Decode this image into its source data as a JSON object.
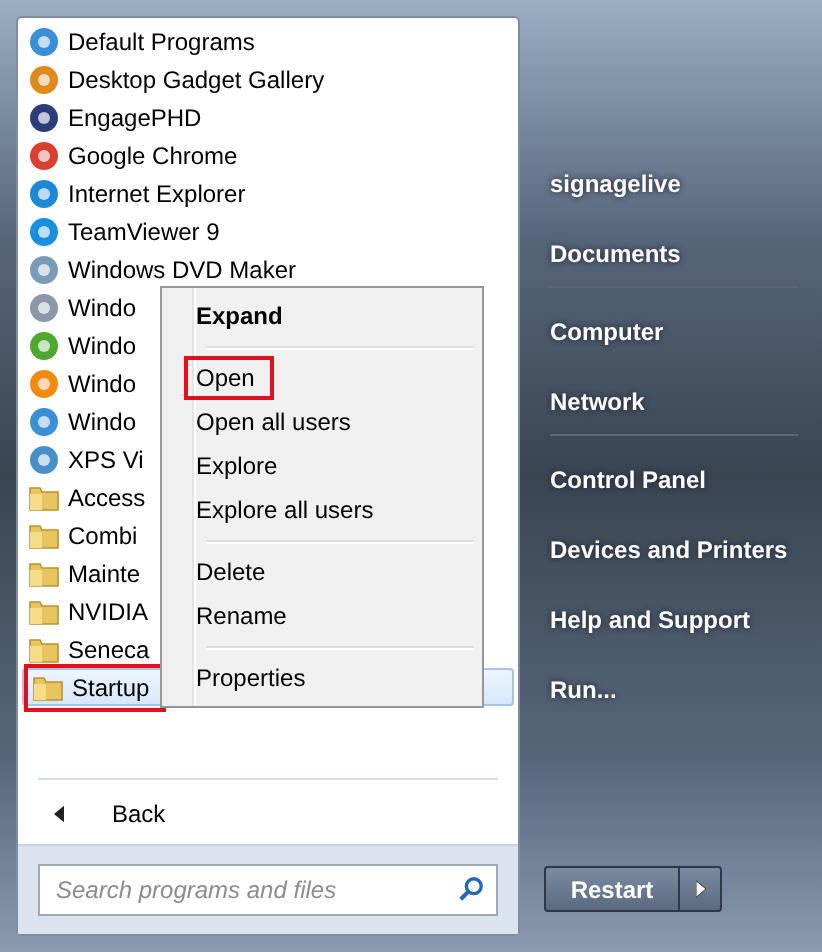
{
  "programs": [
    {
      "label": "Default Programs",
      "kind": "program",
      "selected": false,
      "outlined": false
    },
    {
      "label": "Desktop Gadget Gallery",
      "kind": "program",
      "selected": false,
      "outlined": false
    },
    {
      "label": "EngagePHD",
      "kind": "program",
      "selected": false,
      "outlined": false
    },
    {
      "label": "Google Chrome",
      "kind": "program",
      "selected": false,
      "outlined": false
    },
    {
      "label": "Internet Explorer",
      "kind": "program",
      "selected": false,
      "outlined": false
    },
    {
      "label": "TeamViewer 9",
      "kind": "program",
      "selected": false,
      "outlined": false
    },
    {
      "label": "Windows DVD Maker",
      "kind": "program",
      "selected": false,
      "outlined": false
    },
    {
      "label": "Windo",
      "kind": "program",
      "selected": false,
      "outlined": false
    },
    {
      "label": "Windo",
      "kind": "program",
      "selected": false,
      "outlined": false
    },
    {
      "label": "Windo",
      "kind": "program",
      "selected": false,
      "outlined": false
    },
    {
      "label": "Windo",
      "kind": "program",
      "selected": false,
      "outlined": false
    },
    {
      "label": "XPS Vi",
      "kind": "program",
      "selected": false,
      "outlined": false
    },
    {
      "label": "Access",
      "kind": "folder",
      "selected": false,
      "outlined": false
    },
    {
      "label": "Combi",
      "kind": "folder",
      "selected": false,
      "outlined": false
    },
    {
      "label": "Mainte",
      "kind": "folder",
      "selected": false,
      "outlined": false
    },
    {
      "label": "NVIDIA",
      "kind": "folder",
      "selected": false,
      "outlined": false
    },
    {
      "label": "Seneca",
      "kind": "folder",
      "selected": false,
      "outlined": false
    },
    {
      "label": "Startup",
      "kind": "folder",
      "selected": true,
      "outlined": true
    }
  ],
  "back": {
    "label": "Back"
  },
  "search": {
    "placeholder": "Search programs and files"
  },
  "places": [
    [
      {
        "label": "signagelive"
      },
      {
        "label": "Documents"
      }
    ],
    [
      {
        "label": "Computer"
      },
      {
        "label": "Network"
      }
    ],
    [
      {
        "label": "Control Panel"
      },
      {
        "label": "Devices and Printers"
      },
      {
        "label": "Help and Support"
      },
      {
        "label": "Run..."
      }
    ]
  ],
  "shutdown": {
    "label": "Restart"
  },
  "context_menu": [
    [
      {
        "label": "Expand",
        "default": true,
        "outlined": false
      }
    ],
    [
      {
        "label": "Open",
        "default": false,
        "outlined": true
      },
      {
        "label": "Open all users",
        "default": false,
        "outlined": false
      },
      {
        "label": "Explore",
        "default": false,
        "outlined": false
      },
      {
        "label": "Explore all users",
        "default": false,
        "outlined": false
      }
    ],
    [
      {
        "label": "Delete",
        "default": false,
        "outlined": false
      },
      {
        "label": "Rename",
        "default": false,
        "outlined": false
      }
    ],
    [
      {
        "label": "Properties",
        "default": false,
        "outlined": false
      }
    ]
  ]
}
